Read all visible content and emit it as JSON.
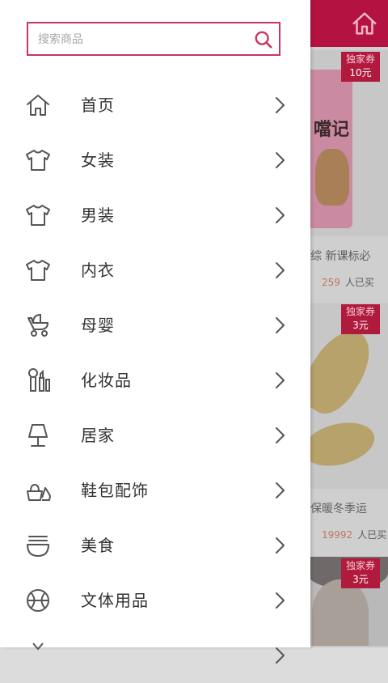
{
  "search": {
    "placeholder": "搜索商品"
  },
  "menu": [
    {
      "label": "首页",
      "icon": "home-icon"
    },
    {
      "label": "女装",
      "icon": "tshirt-icon"
    },
    {
      "label": "男装",
      "icon": "tshirt-icon"
    },
    {
      "label": "内衣",
      "icon": "tshirt-icon"
    },
    {
      "label": "母婴",
      "icon": "stroller-icon"
    },
    {
      "label": "化妆品",
      "icon": "cosmetics-icon"
    },
    {
      "label": "居家",
      "icon": "lamp-icon"
    },
    {
      "label": "鞋包配饰",
      "icon": "bag-shoe-icon"
    },
    {
      "label": "美食",
      "icon": "food-bowl-icon"
    },
    {
      "label": "文体用品",
      "icon": "basketball-icon"
    }
  ],
  "background": {
    "products": [
      {
        "coupon_label": "独家券",
        "coupon_value": "10元",
        "title_fragment": "综 新课标必",
        "sales_count": "259",
        "sales_suffix": "人已买",
        "book_title": "噹记"
      },
      {
        "coupon_label": "独家券",
        "coupon_value": "3元",
        "title_fragment": "保暖冬季运",
        "sales_count": "19992",
        "sales_suffix": "人已买"
      },
      {
        "coupon_label": "独家券",
        "coupon_value": "3元"
      }
    ]
  },
  "colors": {
    "accent": "#c7365e",
    "header_bg": "#b4123f",
    "icon_stroke": "#555555",
    "text": "#333333"
  }
}
